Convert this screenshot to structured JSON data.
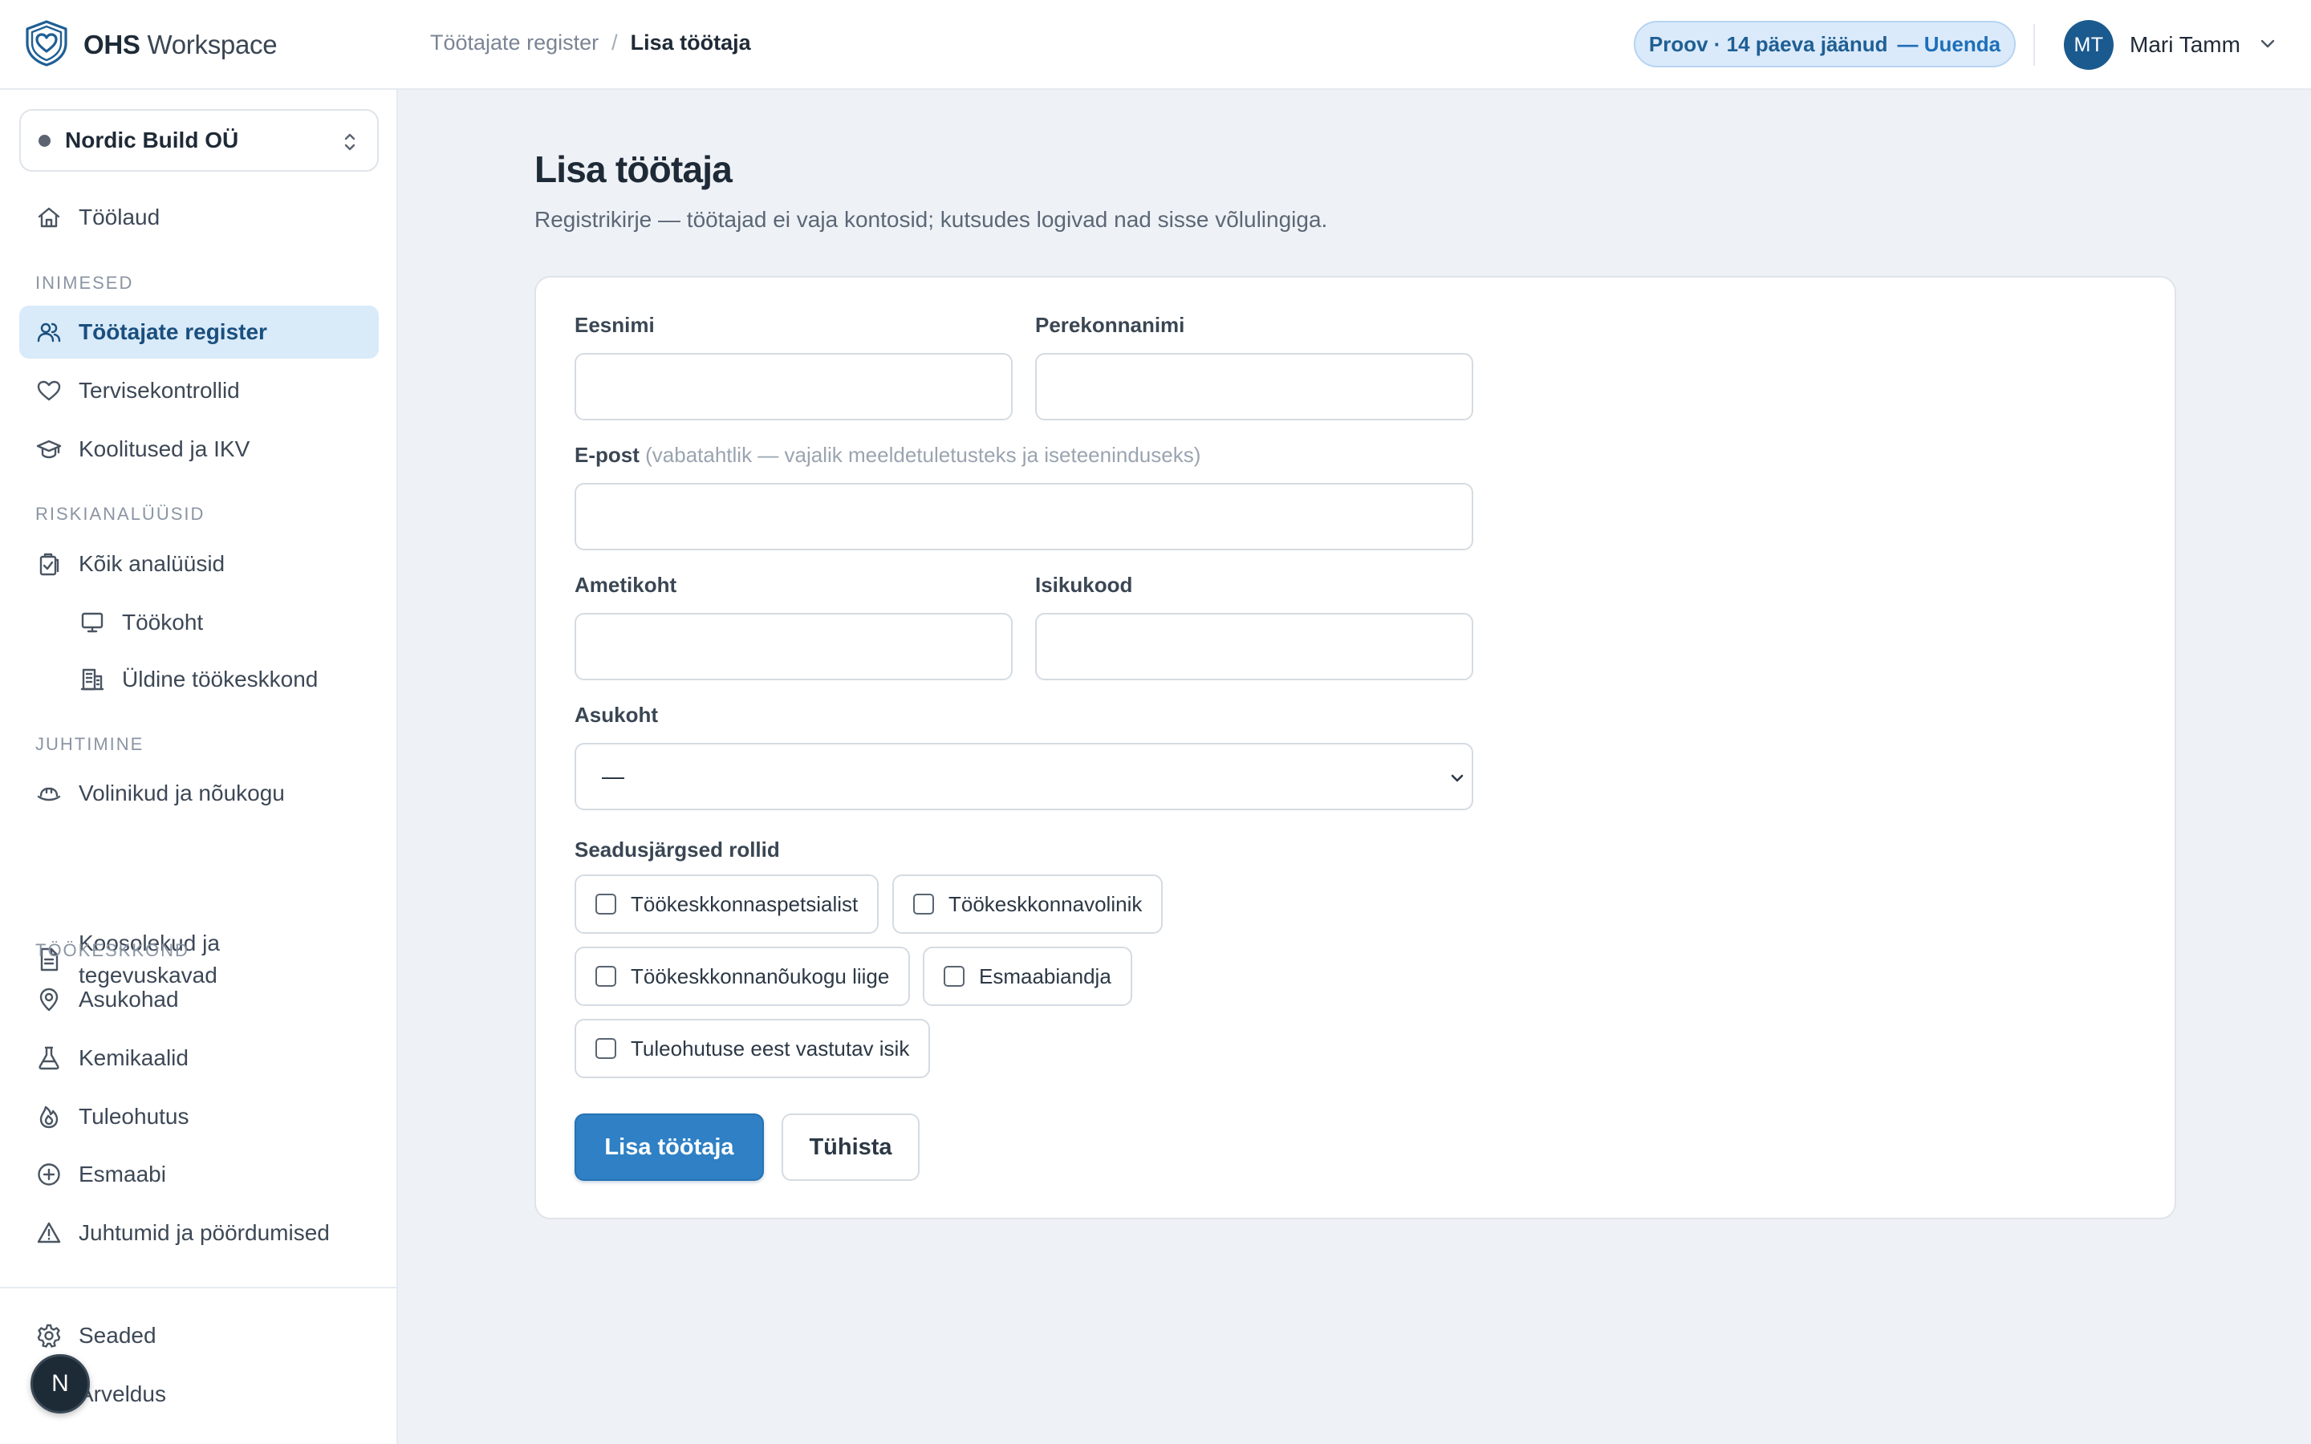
{
  "brand": {
    "bold": "OHS",
    "light": "Workspace"
  },
  "breadcrumb": {
    "parent": "Töötajate register",
    "separator": "/",
    "current": "Lisa töötaja"
  },
  "trial": {
    "text": "Proov · 14 päeva jäänud",
    "action": "— Uuenda"
  },
  "user": {
    "initials": "MT",
    "name": "Mari Tamm"
  },
  "org": {
    "name": "Nordic Build OÜ"
  },
  "sidebar": {
    "dashboard": "Töölaud",
    "section_people": "INIMESED",
    "employees": "Töötajate register",
    "health": "Tervisekontrollid",
    "trainings": "Koolitused ja IKV",
    "section_risk": "RISKIANALÜÜSID",
    "all_analyses": "Kõik analüüsid",
    "workplace": "Töökoht",
    "general_env": "Üldine töökeskkond",
    "section_mgmt": "JUHTIMINE",
    "reps": "Volinikud ja nõukogu",
    "meetings": "Koosolekud ja tegevuskavad",
    "section_env": "TÖÖKESKKOND",
    "locations": "Asukohad",
    "chemicals": "Kemikaalid",
    "fire": "Tuleohutus",
    "first_aid": "Esmaabi",
    "incidents": "Juhtumid ja pöördumised",
    "settings": "Seaded",
    "billing": "Arveldus"
  },
  "fab": {
    "label": "N"
  },
  "page": {
    "title": "Lisa töötaja",
    "subtitle": "Registrikirje — töötajad ei vaja kontosid; kutsudes logivad nad sisse võlulingiga."
  },
  "form": {
    "first_name": {
      "label": "Eesnimi",
      "value": ""
    },
    "last_name": {
      "label": "Perekonnanimi",
      "value": ""
    },
    "email": {
      "label": "E-post",
      "hint": "(vabatahtlik — vajalik meeldetuletusteks ja iseteeninduseks)",
      "value": ""
    },
    "job_title": {
      "label": "Ametikoht",
      "value": ""
    },
    "personal_code": {
      "label": "Isikukood",
      "value": ""
    },
    "location": {
      "label": "Asukoht",
      "selected": "—"
    },
    "roles": {
      "label": "Seadusjärgsed rollid",
      "items": [
        {
          "label": "Töökeskkonnaspetsialist",
          "checked": false
        },
        {
          "label": "Töökeskkonnavolinik",
          "checked": false
        },
        {
          "label": "Töökeskkonnanõukogu liige",
          "checked": false
        },
        {
          "label": "Esmaabiandja",
          "checked": false
        },
        {
          "label": "Tuleohutuse eest vastutav isik",
          "checked": false
        }
      ]
    },
    "submit": "Lisa töötaja",
    "cancel": "Tühista"
  },
  "colors": {
    "accent": "#2f80c4",
    "active_nav_bg": "#d9eaf9",
    "main_bg": "#eef2f6",
    "avatar": "#1b5a8e"
  },
  "icons": {
    "logo": "shield-heart-icon",
    "dashboard": "home-icon",
    "employees": "users-icon",
    "health": "heart-icon",
    "trainings": "graduation-cap-icon",
    "all_analyses": "clipboard-check-icon",
    "workplace": "monitor-icon",
    "general_env": "building-icon",
    "reps": "hard-hat-icon",
    "meetings": "document-icon",
    "locations": "map-pin-icon",
    "chemicals": "flask-icon",
    "fire": "flame-icon",
    "first_aid": "plus-circle-icon",
    "incidents": "warning-icon",
    "settings": "gear-icon"
  }
}
